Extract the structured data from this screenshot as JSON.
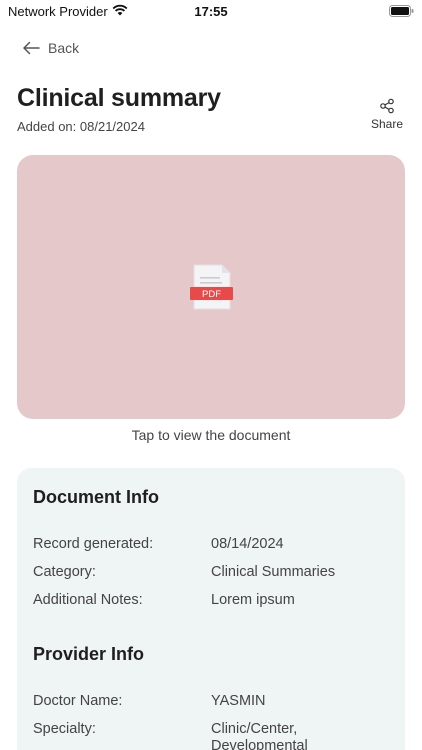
{
  "status_bar": {
    "carrier": "Network Provider",
    "time": "17:55"
  },
  "nav": {
    "back_label": "Back"
  },
  "header": {
    "title": "Clinical summary",
    "added_on": "Added on: 08/21/2024",
    "share_label": "Share"
  },
  "preview": {
    "file_badge": "PDF",
    "tap_text": "Tap to view the document",
    "background_color": "#e5c8ca",
    "badge_color": "#e84a4a"
  },
  "document_info": {
    "title": "Document Info",
    "rows": [
      {
        "label": "Record generated:",
        "value": "08/14/2024"
      },
      {
        "label": "Category:",
        "value": "Clinical Summaries"
      },
      {
        "label": "Additional Notes:",
        "value": "Lorem ipsum"
      }
    ]
  },
  "provider_info": {
    "title": "Provider Info",
    "rows": [
      {
        "label": "Doctor Name:",
        "value": "YASMIN"
      },
      {
        "label": "Specialty:",
        "value": "Clinic/Center,\nDevelopmental"
      }
    ]
  }
}
